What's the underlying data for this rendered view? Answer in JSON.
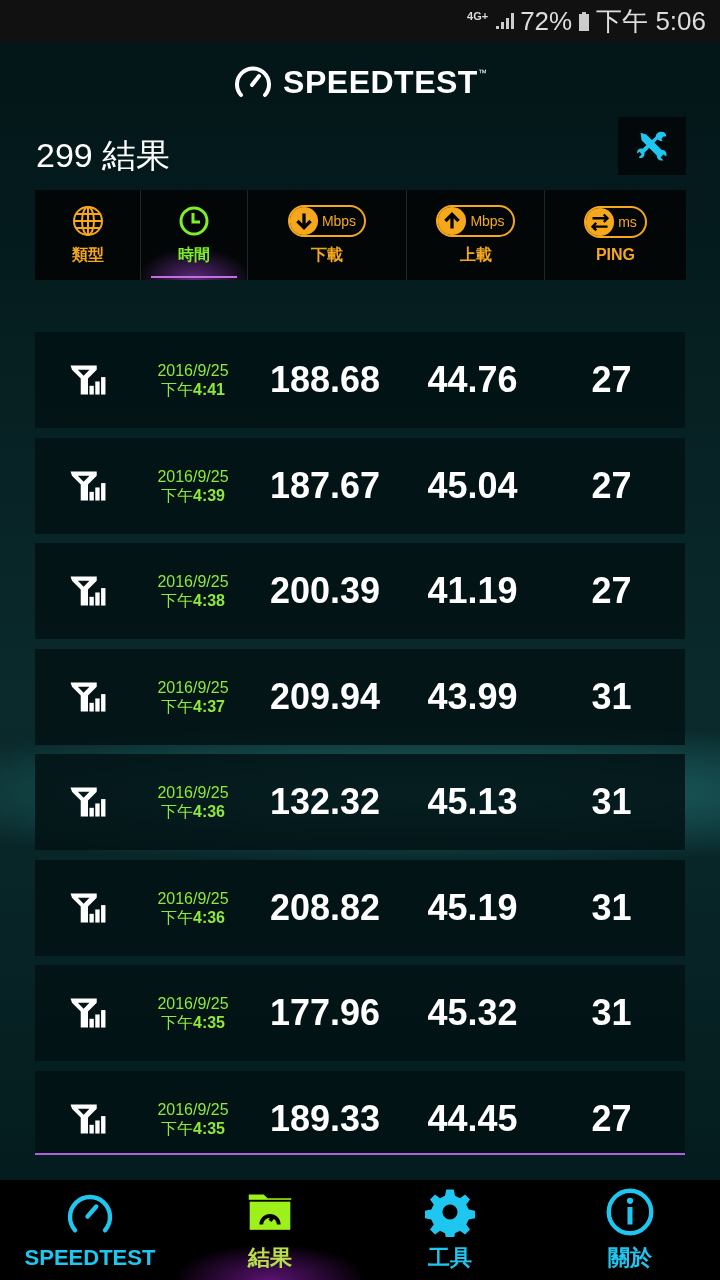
{
  "status_bar": {
    "network": "4G+",
    "battery": "72%",
    "time": "下午 5:06"
  },
  "logo": {
    "text": "SPEEDTEST",
    "mark": "™"
  },
  "title": "299 結果",
  "columns": [
    {
      "kind": "type",
      "label": "類型",
      "selected": false
    },
    {
      "kind": "time",
      "label": "時間",
      "selected": true
    },
    {
      "kind": "download",
      "label": "下載",
      "unit": "Mbps",
      "selected": false
    },
    {
      "kind": "upload",
      "label": "上載",
      "unit": "Mbps",
      "selected": false
    },
    {
      "kind": "ping",
      "label": "PING",
      "unit": "ms",
      "selected": false
    }
  ],
  "rows": [
    {
      "date": "2016/9/25",
      "time": "下午**4:41**",
      "download": "188.68",
      "upload": "44.76",
      "ping": "27"
    },
    {
      "date": "2016/9/25",
      "time": "下午**4:39**",
      "download": "187.67",
      "upload": "45.04",
      "ping": "27"
    },
    {
      "date": "2016/9/25",
      "time": "下午**4:38**",
      "download": "200.39",
      "upload": "41.19",
      "ping": "27"
    },
    {
      "date": "2016/9/25",
      "time": "下午**4:37**",
      "download": "209.94",
      "upload": "43.99",
      "ping": "31"
    },
    {
      "date": "2016/9/25",
      "time": "下午**4:36**",
      "download": "132.32",
      "upload": "45.13",
      "ping": "31"
    },
    {
      "date": "2016/9/25",
      "time": "下午**4:36**",
      "download": "208.82",
      "upload": "45.19",
      "ping": "31"
    },
    {
      "date": "2016/9/25",
      "time": "下午**4:35**",
      "download": "177.96",
      "upload": "45.32",
      "ping": "31"
    },
    {
      "date": "2016/9/25",
      "time": "下午**4:35**",
      "download": "189.33",
      "upload": "44.45",
      "ping": "27"
    }
  ],
  "nav": [
    {
      "kind": "speedtest",
      "label": "SPEEDTEST",
      "selected": false
    },
    {
      "kind": "results",
      "label": "結果",
      "selected": true
    },
    {
      "kind": "tools",
      "label": "工具",
      "selected": false
    },
    {
      "kind": "about",
      "label": "關於",
      "selected": false
    }
  ]
}
